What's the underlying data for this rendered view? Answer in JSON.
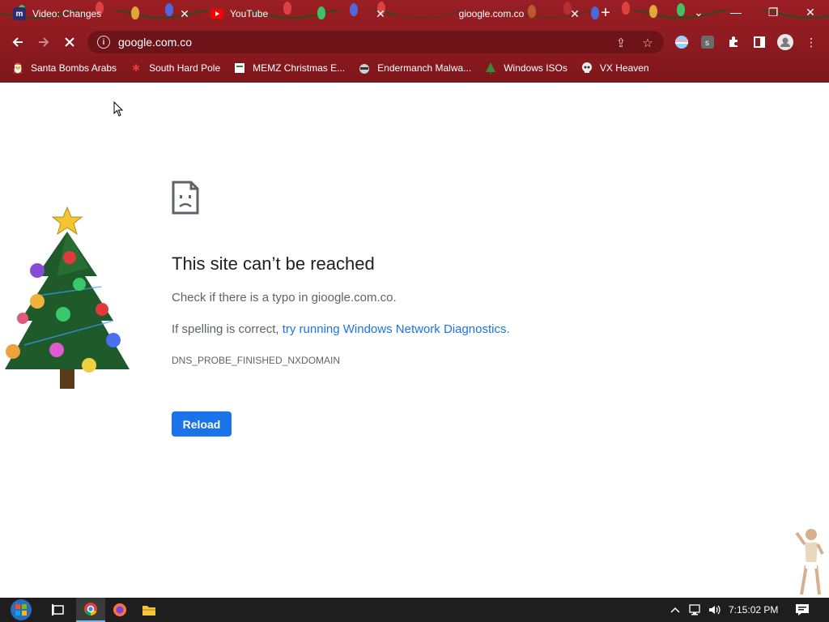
{
  "window": {
    "tabs": [
      {
        "title": "Video: Changes",
        "icon": "m-app-icon"
      },
      {
        "title": "YouTube",
        "icon": "youtube-icon"
      },
      {
        "title": "gioogle.com.co",
        "icon": "loading-icon"
      }
    ],
    "active_tab_index": 2,
    "new_tab_label": "+",
    "controls": {
      "tab_search": "⌄",
      "minimize": "—",
      "restore": "❐",
      "close": "✕"
    }
  },
  "toolbar": {
    "address": "google.com.co",
    "address_icon": "info-icon"
  },
  "bookmarks": [
    {
      "label": "Santa Bombs Arabs",
      "icon": "santa-icon"
    },
    {
      "label": "South Hard Pole",
      "icon": "snowflake-icon"
    },
    {
      "label": "MEMZ Christmas E...",
      "icon": "page-icon"
    },
    {
      "label": "Endermanch Malwa...",
      "icon": "raccoon-icon"
    },
    {
      "label": "Windows ISOs",
      "icon": "tree-icon"
    },
    {
      "label": "VX Heaven",
      "icon": "skull-icon"
    }
  ],
  "error": {
    "title": "This site can’t be reached",
    "line1": "Check if there is a typo in gioogle.com.co.",
    "line2_prefix": "If spelling is correct, ",
    "line2_link": "try running Windows Network Diagnostics",
    "line2_suffix": ".",
    "code": "DNS_PROBE_FINISHED_NXDOMAIN",
    "reload_label": "Reload"
  },
  "taskbar": {
    "clock": "7:15:02 PM",
    "accent": "#76b9ed"
  },
  "colors": {
    "chrome_bg": "#8a1a1f",
    "link": "#1a73e8",
    "button": "#1a73e8"
  }
}
